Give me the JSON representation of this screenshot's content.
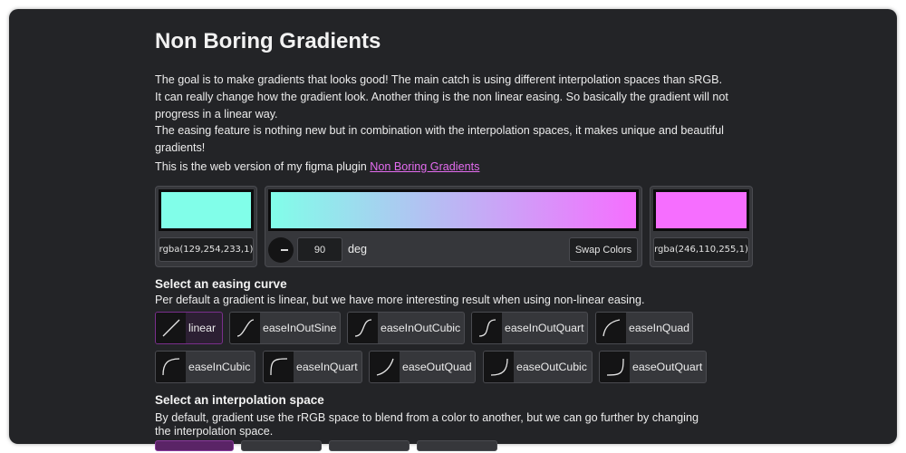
{
  "page": {
    "title": "Non Boring Gradients",
    "intro_lines": [
      "The goal is to make gradients that looks good! The main catch is using different interpolation spaces than sRGB.",
      "It can really change how the gradient look. Another thing is the non linear easing. So basically the gradient will not progress in a linear way.",
      "The easing feature is nothing new but in combination with the interpolation spaces, it makes unique and beautiful gradients!"
    ],
    "plugin_prefix": "This is the web version of my figma plugin ",
    "plugin_link": "Non Boring Gradients"
  },
  "gradient": {
    "start_color": "#81FEE9",
    "end_color": "#F66EFF",
    "start_rgba": "rgba(129,254,233,1)",
    "end_rgba": "rgba(246,110,255,1)",
    "angle": "90",
    "angle_unit": "deg",
    "swap_label": "Swap Colors"
  },
  "easing": {
    "heading": "Select an easing curve",
    "description": "Per default a gradient is linear, but we have more interesting result when using non-linear easing.",
    "selected": "linear",
    "items": [
      {
        "label": "linear",
        "icon": "linear-curve-icon"
      },
      {
        "label": "easeInOutSine",
        "icon": "ease-in-out-sine-curve-icon"
      },
      {
        "label": "easeInOutCubic",
        "icon": "ease-in-out-cubic-curve-icon"
      },
      {
        "label": "easeInOutQuart",
        "icon": "ease-in-out-quart-curve-icon"
      },
      {
        "label": "easeInQuad",
        "icon": "ease-in-quad-curve-icon"
      },
      {
        "label": "easeInCubic",
        "icon": "ease-in-cubic-curve-icon"
      },
      {
        "label": "easeInQuart",
        "icon": "ease-in-quart-curve-icon"
      },
      {
        "label": "easeOutQuad",
        "icon": "ease-out-quad-curve-icon"
      },
      {
        "label": "easeOutCubic",
        "icon": "ease-out-cubic-curve-icon"
      },
      {
        "label": "easeOutQuart",
        "icon": "ease-out-quart-curve-icon"
      }
    ]
  },
  "interpolation": {
    "heading": "Select an interpolation space",
    "description": "By default, gradient use the rRGB space to blend from a color to another, but we can go further by changing the interpolation space."
  },
  "colors": {
    "background": "#232427",
    "accent": "#E46CF0"
  }
}
